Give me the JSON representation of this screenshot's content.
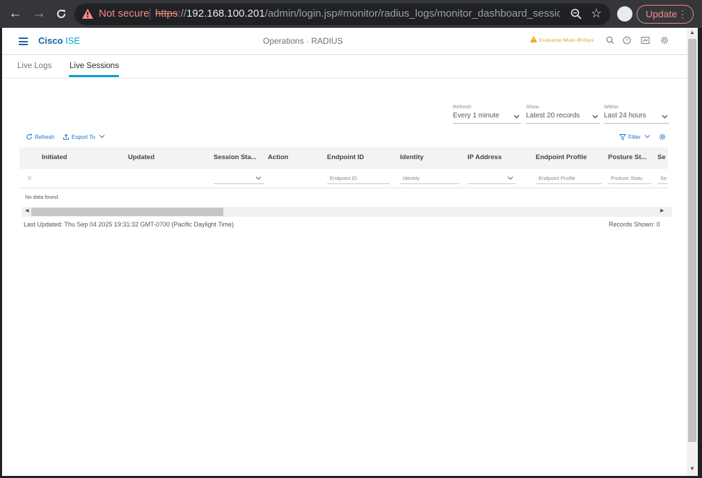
{
  "browser": {
    "not_secure": "Not secure",
    "url_scheme": "https",
    "url_host": "192.168.100.201",
    "url_path": "/admin/login.jsp#monitor/radius_logs/monitor_dashboard_sessionlivel...",
    "update_label": "Update",
    "icons": [
      "back-arrow-icon",
      "forward-arrow-icon",
      "reload-icon",
      "warning-icon",
      "zoom-icon",
      "star-icon",
      "profile-avatar",
      "menu-dots-icon"
    ]
  },
  "header": {
    "brand": "Cisco",
    "product": "ISE",
    "title": "Operations · RADIUS",
    "evaluation": "Evaluation Mode 49 Days",
    "icons": [
      "search-icon",
      "help-icon",
      "notifications-icon",
      "settings-icon"
    ]
  },
  "tabs": [
    {
      "label": "Live Logs",
      "active": false
    },
    {
      "label": "Live Sessions",
      "active": true
    }
  ],
  "filters": {
    "refresh": {
      "label": "Refresh",
      "value": "Every 1 minute"
    },
    "show": {
      "label": "Show",
      "value": "Latest 20 records"
    },
    "within": {
      "label": "Within",
      "value": "Last 24 hours"
    }
  },
  "toolbar": {
    "refresh": "Refresh",
    "export": "Export To",
    "filter": "Filter"
  },
  "table": {
    "columns": [
      "Initiated",
      "Updated",
      "Session Sta...",
      "Action",
      "Endpoint ID",
      "Identity",
      "IP Address",
      "Endpoint Profile",
      "Posture St...",
      "Se"
    ],
    "filter_placeholders": {
      "endpoint_id": "Endpoint ID",
      "identity": "Identity",
      "endpoint_profile": "Endpoint Profile",
      "posture_status": "Posture Statu",
      "se": "Se"
    },
    "empty_text": "No data found."
  },
  "footer": {
    "last_updated": "Last Updated: Thu Sep 04 2025 19:31:32 GMT-0700 (Pacific Daylight Time)",
    "records_shown": "Records Shown: 0"
  },
  "colors": {
    "accent": "#049fd9",
    "brand": "#0a64a4",
    "warning": "#f28b82",
    "eval": "#d9a300"
  }
}
